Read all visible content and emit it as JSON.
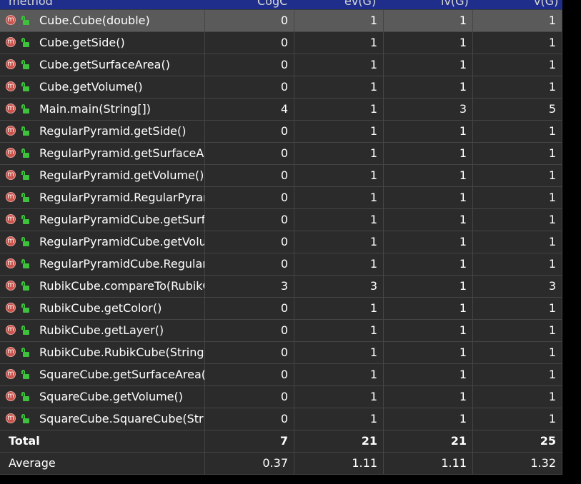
{
  "columns": [
    "method",
    "CogC",
    "ev(G)",
    "iv(G)",
    "v(G)"
  ],
  "rows": [
    {
      "method": "Cube.Cube(double)",
      "cogc": "0",
      "evg": "1",
      "ivg": "1",
      "vg": "1"
    },
    {
      "method": "Cube.getSide()",
      "cogc": "0",
      "evg": "1",
      "ivg": "1",
      "vg": "1"
    },
    {
      "method": "Cube.getSurfaceArea()",
      "cogc": "0",
      "evg": "1",
      "ivg": "1",
      "vg": "1"
    },
    {
      "method": "Cube.getVolume()",
      "cogc": "0",
      "evg": "1",
      "ivg": "1",
      "vg": "1"
    },
    {
      "method": "Main.main(String[])",
      "cogc": "4",
      "evg": "1",
      "ivg": "3",
      "vg": "5"
    },
    {
      "method": "RegularPyramid.getSide()",
      "cogc": "0",
      "evg": "1",
      "ivg": "1",
      "vg": "1"
    },
    {
      "method": "RegularPyramid.getSurfaceAre",
      "cogc": "0",
      "evg": "1",
      "ivg": "1",
      "vg": "1"
    },
    {
      "method": "RegularPyramid.getVolume()",
      "cogc": "0",
      "evg": "1",
      "ivg": "1",
      "vg": "1"
    },
    {
      "method": "RegularPyramid.RegularPyrami",
      "cogc": "0",
      "evg": "1",
      "ivg": "1",
      "vg": "1"
    },
    {
      "method": "RegularPyramidCube.getSurfac",
      "cogc": "0",
      "evg": "1",
      "ivg": "1",
      "vg": "1"
    },
    {
      "method": "RegularPyramidCube.getVolum",
      "cogc": "0",
      "evg": "1",
      "ivg": "1",
      "vg": "1"
    },
    {
      "method": "RegularPyramidCube.RegularP",
      "cogc": "0",
      "evg": "1",
      "ivg": "1",
      "vg": "1"
    },
    {
      "method": "RubikCube.compareTo(RubikC",
      "cogc": "3",
      "evg": "3",
      "ivg": "1",
      "vg": "3"
    },
    {
      "method": "RubikCube.getColor()",
      "cogc": "0",
      "evg": "1",
      "ivg": "1",
      "vg": "1"
    },
    {
      "method": "RubikCube.getLayer()",
      "cogc": "0",
      "evg": "1",
      "ivg": "1",
      "vg": "1"
    },
    {
      "method": "RubikCube.RubikCube(String,",
      "cogc": "0",
      "evg": "1",
      "ivg": "1",
      "vg": "1"
    },
    {
      "method": "SquareCube.getSurfaceArea()",
      "cogc": "0",
      "evg": "1",
      "ivg": "1",
      "vg": "1"
    },
    {
      "method": "SquareCube.getVolume()",
      "cogc": "0",
      "evg": "1",
      "ivg": "1",
      "vg": "1"
    },
    {
      "method": "SquareCube.SquareCube(Strin",
      "cogc": "0",
      "evg": "1",
      "ivg": "1",
      "vg": "1"
    }
  ],
  "total": {
    "label": "Total",
    "cogc": "7",
    "evg": "21",
    "ivg": "21",
    "vg": "25"
  },
  "average": {
    "label": "Average",
    "cogc": "0.37",
    "evg": "1.11",
    "ivg": "1.11",
    "vg": "1.32"
  },
  "icons": {
    "method": "method-icon",
    "visibility": "public-lock-icon"
  },
  "colors": {
    "selected_row": "#5a5a5a",
    "header": "#1f2e8a",
    "method_icon": "#c9544c",
    "lock_icon": "#3ec23e"
  }
}
